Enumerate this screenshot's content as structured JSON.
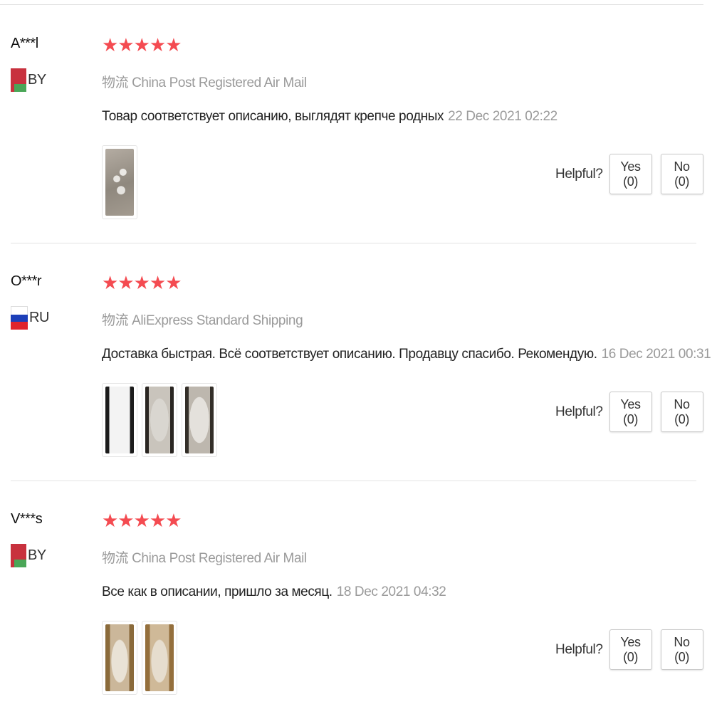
{
  "helpful_label": "Helpful?",
  "colors": {
    "star": "#f44b51",
    "muted_text": "#9a9a9a",
    "divider": "#e3e3e3"
  },
  "reviews": [
    {
      "username": "A***l",
      "country_code": "BY",
      "flag_icon": "belarus-flag-icon",
      "stars": "★★★★★",
      "rating": 5,
      "shipping": "物流 China Post Registered Air Mail",
      "text": "Товар соответствует описанию, выглядят крепче родных",
      "date": "22 Dec 2021 02:22",
      "photo_count": 1,
      "yes_label": "Yes (0)",
      "no_label": "No (0)"
    },
    {
      "username": "O***r",
      "country_code": "RU",
      "flag_icon": "russia-flag-icon",
      "stars": "★★★★★",
      "rating": 5,
      "shipping": "物流 AliExpress Standard Shipping",
      "text": "Доставка быстрая. Всё соответствует описанию. Продавцу спасибо. Рекомендую.",
      "date": "16 Dec 2021 00:31",
      "photo_count": 3,
      "yes_label": "Yes (0)",
      "no_label": "No (0)"
    },
    {
      "username": "V***s",
      "country_code": "BY",
      "flag_icon": "belarus-flag-icon",
      "stars": "★★★★★",
      "rating": 5,
      "shipping": "物流 China Post Registered Air Mail",
      "text": "Все как в описании, пришло за месяц.",
      "date": "18 Dec 2021 04:32",
      "photo_count": 2,
      "yes_label": "Yes (0)",
      "no_label": "No (0)"
    }
  ]
}
